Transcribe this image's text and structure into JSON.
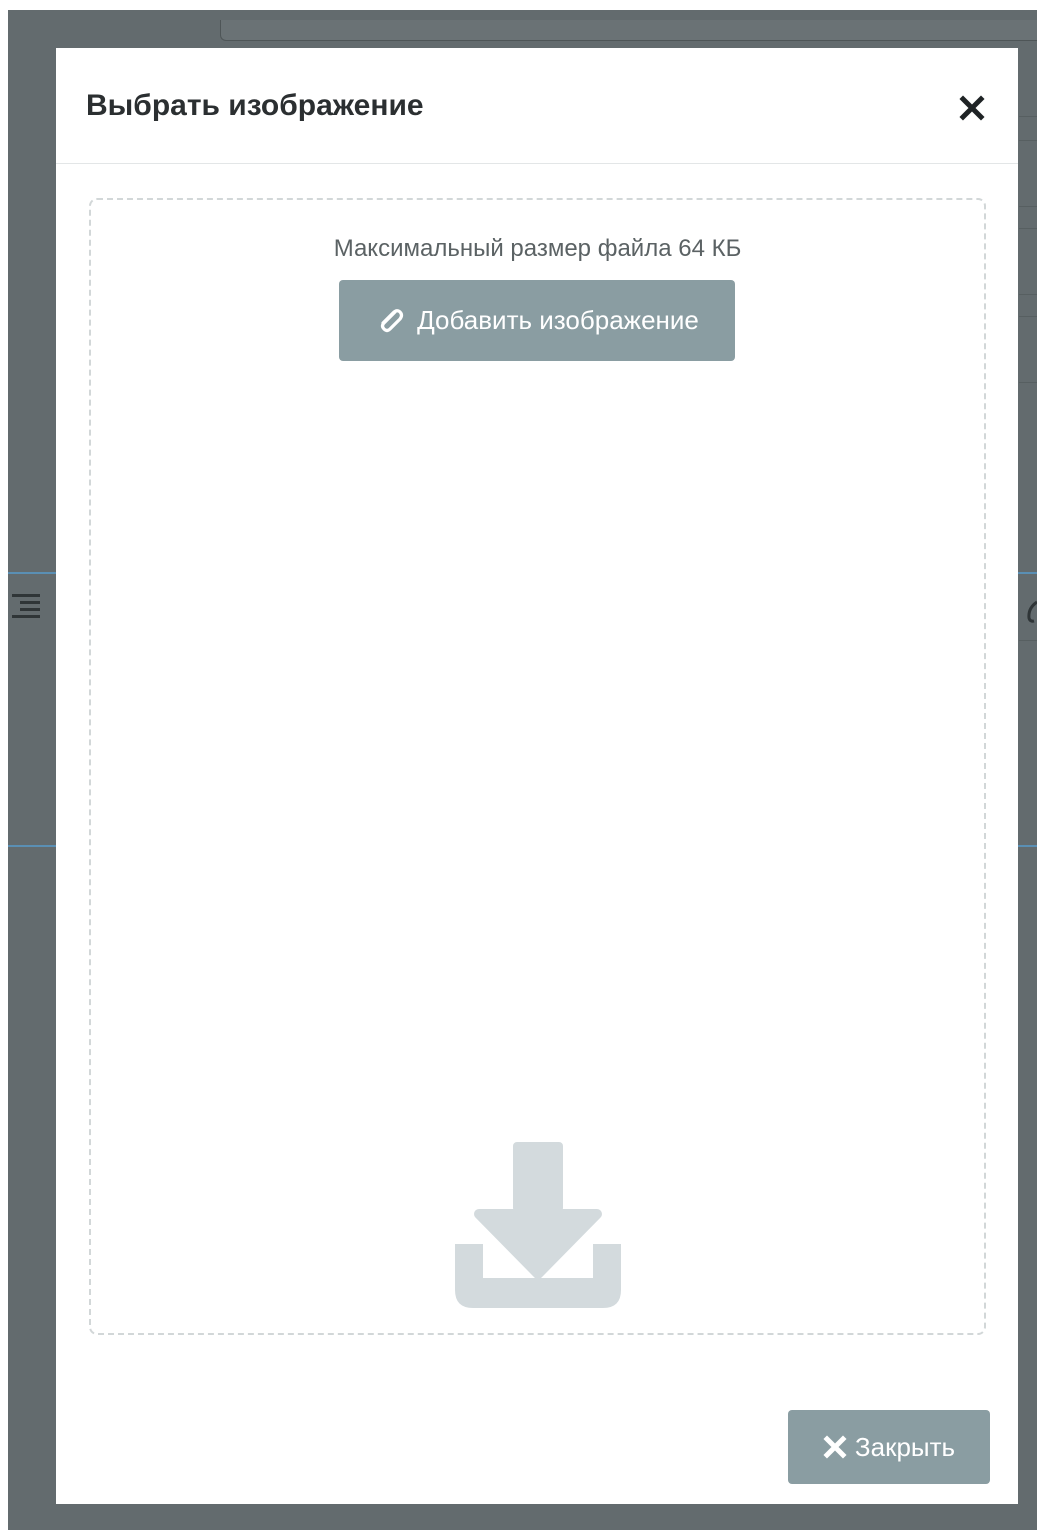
{
  "modal": {
    "title": "Выбрать изображение",
    "close_icon": "close-icon"
  },
  "dropzone": {
    "max_size_text": "Максимальный размер файла 64 КБ",
    "add_button_label": "Добавить изображение",
    "add_button_icon": "paperclip-icon",
    "drop_icon": "download-icon"
  },
  "footer": {
    "close_button_label": "Закрыть",
    "close_button_icon": "close-icon"
  },
  "colors": {
    "backdrop": "#636b6e",
    "button_bg": "#8a9da2",
    "title_text": "#2b2f31",
    "muted_text": "#5b6264",
    "dashed_border": "#d2d7d8",
    "drop_icon": "#d3dadd",
    "accent_line": "#5a8fb4"
  }
}
